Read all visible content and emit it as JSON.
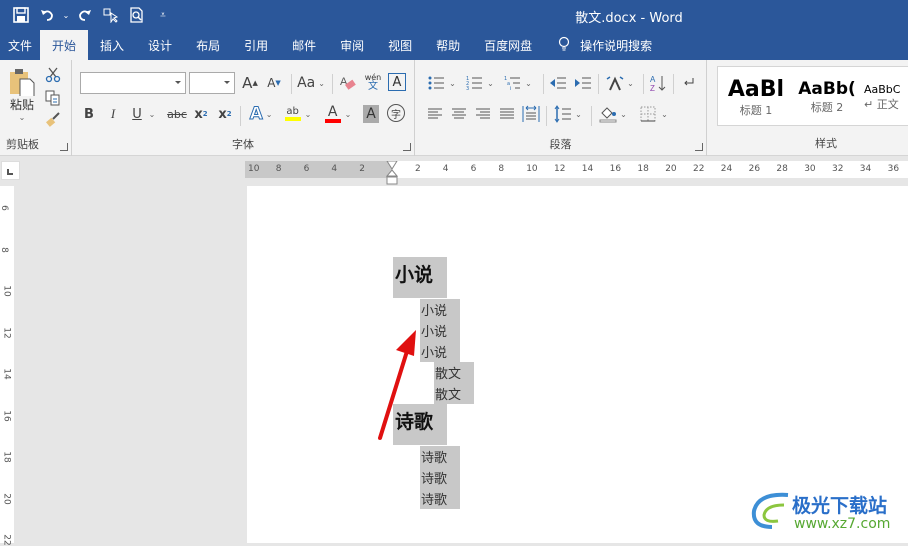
{
  "window": {
    "title": "散文.docx - Word"
  },
  "qat": {
    "save": "save-icon",
    "undo": "undo-icon",
    "redo": "redo-icon",
    "touch": "touch-mode-icon",
    "preview": "print-preview-icon",
    "customize": "customize-icon"
  },
  "tabs": [
    {
      "label": "文件"
    },
    {
      "label": "开始",
      "active": true
    },
    {
      "label": "插入"
    },
    {
      "label": "设计"
    },
    {
      "label": "布局"
    },
    {
      "label": "引用"
    },
    {
      "label": "邮件"
    },
    {
      "label": "审阅"
    },
    {
      "label": "视图"
    },
    {
      "label": "帮助"
    },
    {
      "label": "百度网盘"
    },
    {
      "label": "操作说明搜索"
    }
  ],
  "ribbon": {
    "clipboard": {
      "label": "剪贴板",
      "paste": "粘贴"
    },
    "font": {
      "label": "字体",
      "font_name": "",
      "font_size": "",
      "grow": "A",
      "shrink": "A",
      "case": "Aa",
      "pinyin_top": "wén",
      "pinyin_bottom": "文",
      "border_char": "A",
      "bold": "B",
      "italic": "I",
      "underline": "U",
      "strike": "abc",
      "sub": "x",
      "sup": "x",
      "effects": "A",
      "highlight": "ab",
      "font_color": "A",
      "shading": "A",
      "enclose": "字",
      "highlight_color": "#ffff00",
      "font_color_value": "#ff0000"
    },
    "paragraph": {
      "label": "段落"
    },
    "styles": {
      "label": "样式",
      "items": [
        {
          "preview": "AaBl",
          "name": "标题 1"
        },
        {
          "preview": "AaBb(",
          "name": "标题 2"
        },
        {
          "preview": "AaBbC",
          "name": "正文"
        }
      ]
    }
  },
  "ruler": {
    "h_left": [
      "10",
      "8",
      "6",
      "4",
      "2"
    ],
    "h_right": [
      "2",
      "4",
      "6",
      "8",
      "10",
      "12",
      "14",
      "16",
      "18",
      "20",
      "22",
      "24",
      "26",
      "28",
      "30",
      "32",
      "34",
      "36"
    ],
    "v": [
      "6",
      "8",
      "10",
      "12",
      "14",
      "16",
      "18",
      "20",
      "22"
    ]
  },
  "document": {
    "lines": [
      {
        "text": "小说",
        "level": 1
      },
      {
        "text": "小说",
        "level": 2
      },
      {
        "text": "小说",
        "level": 2
      },
      {
        "text": "小说",
        "level": 2
      },
      {
        "text": "散文",
        "level": 3
      },
      {
        "text": "散文",
        "level": 3
      },
      {
        "text": "诗歌",
        "level": 1
      },
      {
        "text": "诗歌",
        "level": 2
      },
      {
        "text": "诗歌",
        "level": 2
      },
      {
        "text": "诗歌",
        "level": 2
      }
    ]
  },
  "watermark": {
    "name": "极光下载站",
    "url": "www.xz7.com"
  }
}
